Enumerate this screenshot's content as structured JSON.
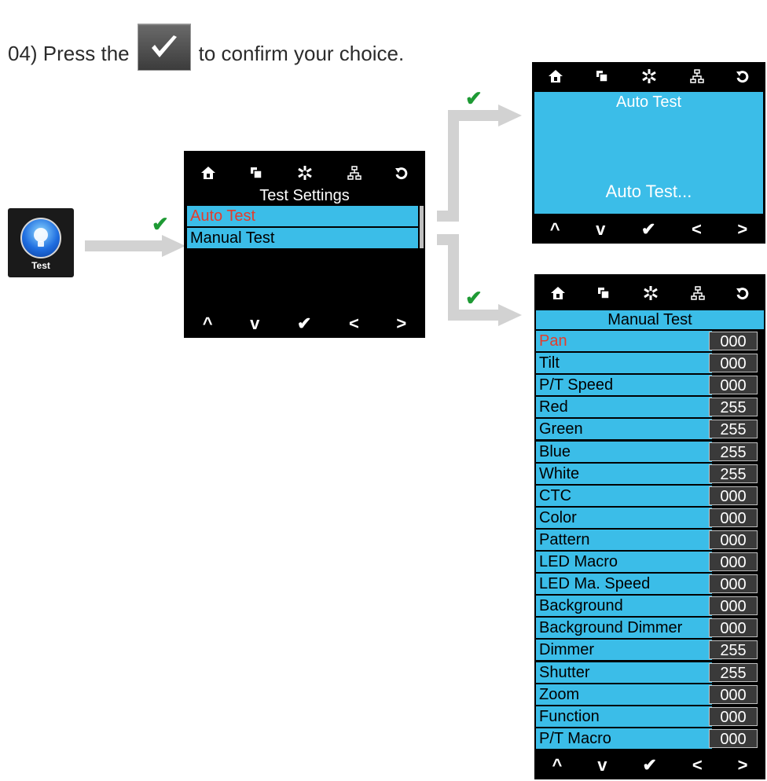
{
  "instruction": {
    "before": "04)  Press the",
    "after": "to confirm your choice."
  },
  "app_icon": {
    "label": "Test",
    "icon": "lightbulb-icon"
  },
  "nav_icons": [
    "home-icon",
    "copy-icon",
    "settings-icon",
    "network-icon",
    "back-icon"
  ],
  "bottom_icons": [
    "up-icon",
    "down-icon",
    "check-icon",
    "left-icon",
    "right-icon"
  ],
  "test_settings": {
    "title": "Test Settings",
    "items": [
      "Auto Test",
      "Manual Test"
    ]
  },
  "auto_test": {
    "title": "Auto Test",
    "message": "Auto Test..."
  },
  "manual_test": {
    "title": "Manual Test",
    "rows": [
      {
        "label": "Pan",
        "value": "000"
      },
      {
        "label": "Tilt",
        "value": "000"
      },
      {
        "label": "P/T Speed",
        "value": "000"
      },
      {
        "label": "Red",
        "value": "255"
      },
      {
        "label": "Green",
        "value": "255"
      },
      {
        "label": "Blue",
        "value": "255"
      },
      {
        "label": "White",
        "value": "255"
      },
      {
        "label": "CTC",
        "value": "000"
      },
      {
        "label": "Color",
        "value": "000"
      },
      {
        "label": "Pattern",
        "value": "000"
      },
      {
        "label": "LED Macro",
        "value": "000"
      },
      {
        "label": "LED Ma. Speed",
        "value": "000"
      },
      {
        "label": "Background",
        "value": "000"
      },
      {
        "label": "Background Dimmer",
        "value": "000"
      },
      {
        "label": "Dimmer",
        "value": "255"
      },
      {
        "label": "Shutter",
        "value": "255"
      },
      {
        "label": "Zoom",
        "value": "000"
      },
      {
        "label": "Function",
        "value": "000"
      },
      {
        "label": "P/T Macro",
        "value": "000"
      }
    ]
  },
  "colors": {
    "row_bg": "#3bbde8",
    "selected_text": "#e53c2b",
    "check_green": "#1e9a34",
    "screen_bg": "#000000"
  }
}
